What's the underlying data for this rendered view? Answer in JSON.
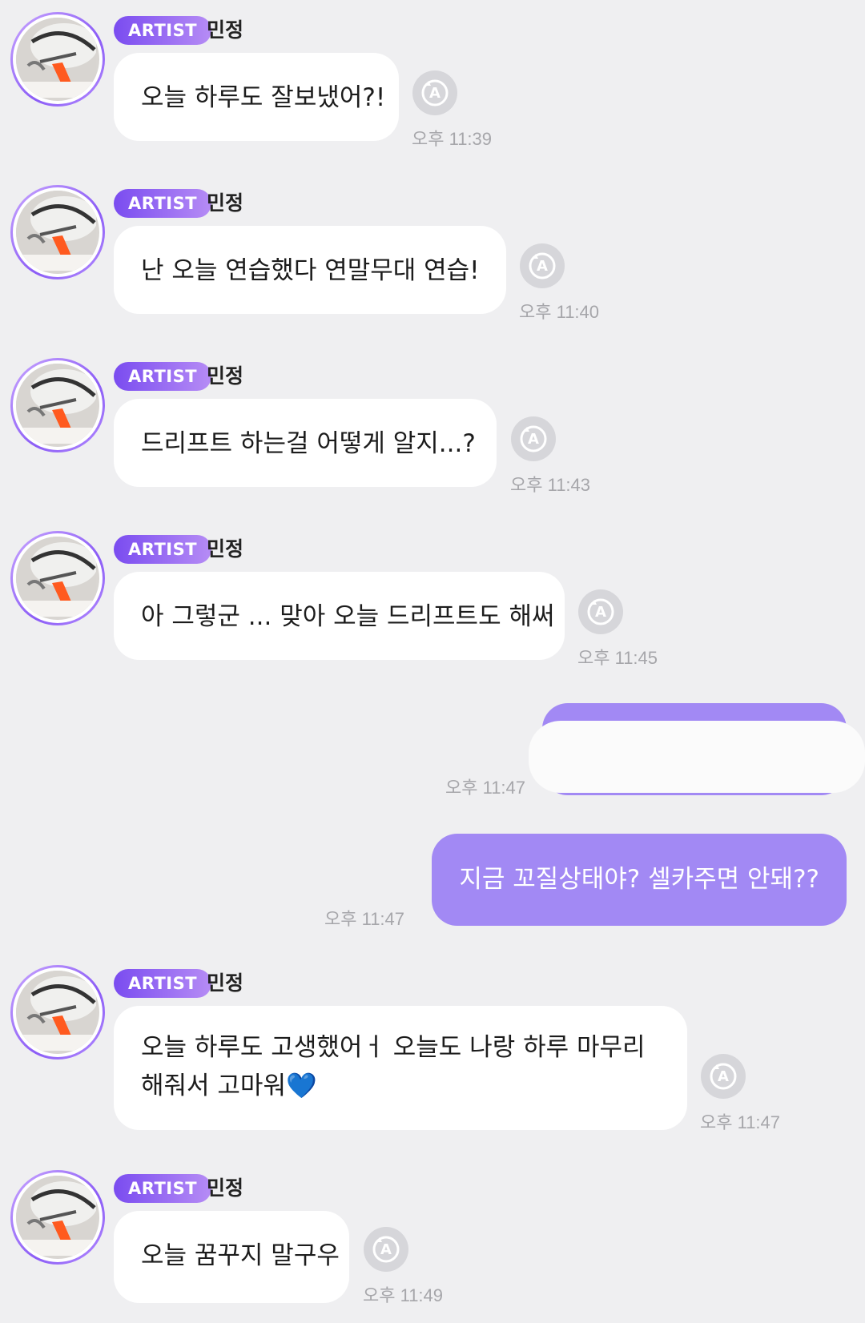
{
  "artist_badge": "ARTIST",
  "artist_name": "민정",
  "messages": [
    {
      "text": "오늘 하루도 잘보냈어?!",
      "time": "오후 11:39"
    },
    {
      "text": "난 오늘 연습했다 연말무대 연습!",
      "time": "오후 11:40"
    },
    {
      "text": "드리프트 하는걸 어떻게 알지...?",
      "time": "오후 11:43"
    },
    {
      "text": "아 그렇군 ... 맞아 오늘 드리프트도 해써",
      "time": "오후 11:45"
    },
    {
      "text": "오늘 하루도 고생했어ㅓ 오늘도 나랑 하루 마무리",
      "text2": "해줘서 고마워💙",
      "time": "오후 11:47"
    },
    {
      "text": "오늘 꿈꾸지 말구우",
      "time": "오후 11:49"
    }
  ],
  "sent": [
    {
      "text": "",
      "time": "오후 11:47",
      "redacted": true
    },
    {
      "text": "지금 꼬질상태야? 셀카주면 안돼??",
      "time": "오후 11:47"
    }
  ],
  "colors": {
    "background": "#efeff1",
    "incoming_bubble": "#ffffff",
    "outgoing_bubble": "#a289f4",
    "badge_gradient_start": "#7a4cf0",
    "badge_gradient_end": "#b68cf5",
    "timestamp": "#a6a6aa"
  },
  "icons": {
    "reply": "circular-arrow-a-icon",
    "avatar": "artist-avatar-photo"
  }
}
